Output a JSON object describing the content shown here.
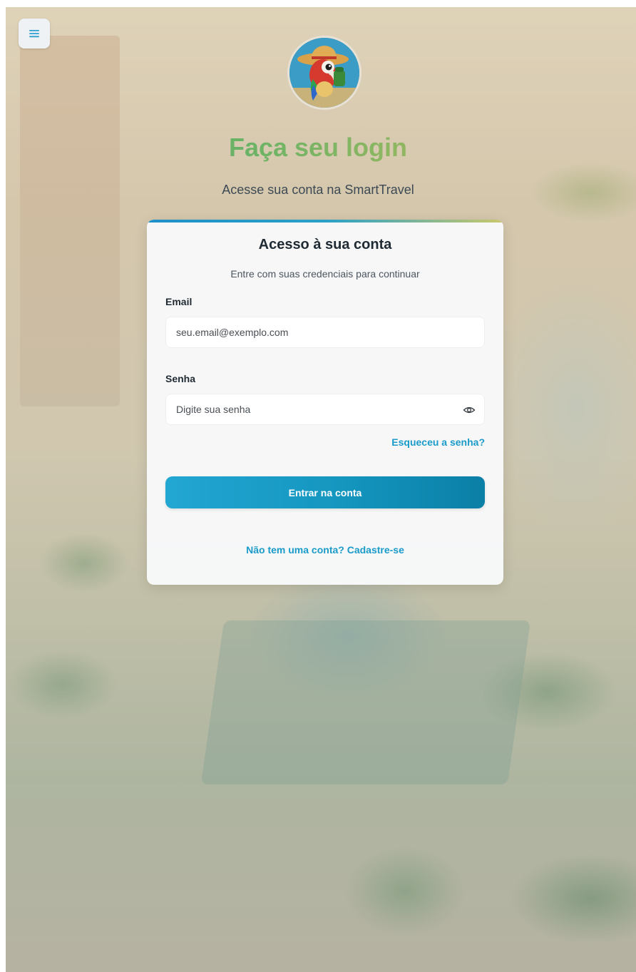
{
  "header": {
    "title": "Faça seu login",
    "subtitle": "Acesse sua conta na SmartTravel"
  },
  "card": {
    "title": "Acesso à sua conta",
    "subtitle": "Entre com suas credenciais para continuar",
    "email": {
      "label": "Email",
      "placeholder": "seu.email@exemplo.com",
      "value": ""
    },
    "password": {
      "label": "Senha",
      "placeholder": "Digite sua senha",
      "value": ""
    },
    "forgot_link": "Esqueceu a senha?",
    "submit_label": "Entrar na conta",
    "signup_link": "Não tem uma conta? Cadastre-se"
  },
  "icons": {
    "menu": "menu-icon",
    "avatar": "parrot-mascot",
    "password_toggle": "eye-icon"
  },
  "colors": {
    "accent": "#1a9bc9",
    "button_start": "#22a6d2",
    "button_end": "#0b7fa6",
    "title_green": "#2e9e60",
    "title_yellow": "#c8b84a"
  }
}
